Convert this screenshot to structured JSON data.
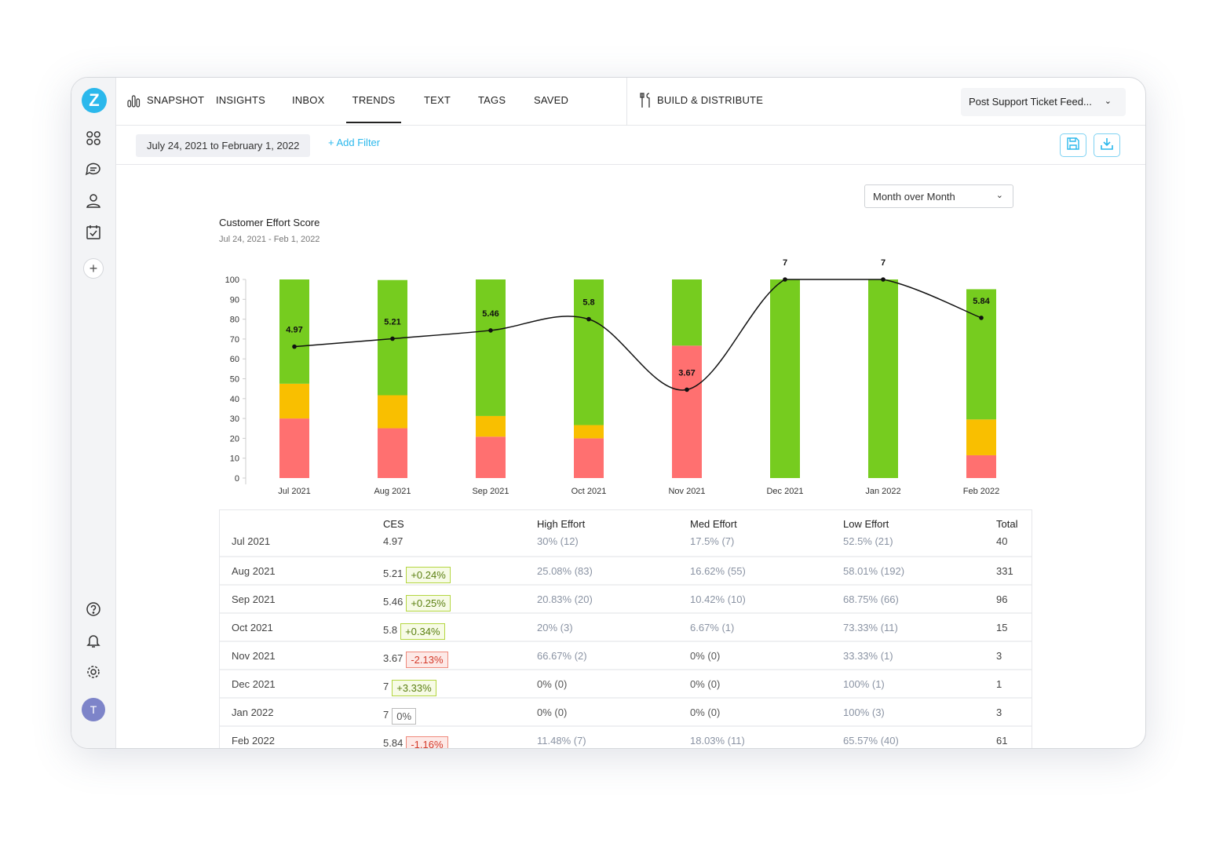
{
  "logo": "Z",
  "nav": {
    "tabs": [
      {
        "label": "SNAPSHOT"
      },
      {
        "label": "INSIGHTS"
      },
      {
        "label": "INBOX"
      },
      {
        "label": "TRENDS",
        "active": true
      },
      {
        "label": "TEXT"
      },
      {
        "label": "TAGS"
      },
      {
        "label": "SAVED"
      }
    ],
    "build": "BUILD & DISTRIBUTE",
    "survey": "Post Support Ticket Feed..."
  },
  "filter": {
    "date_range": "July 24, 2021 to February 1, 2022",
    "add_filter": "+ Add Filter"
  },
  "sidebar": {
    "avatar": "T"
  },
  "view_select": "Month over Month",
  "colors": {
    "accent": "#2bb8ec",
    "high": "#ff7070",
    "med": "#f9bf00",
    "low": "#76cc1f"
  },
  "chart_data": {
    "type": "bar",
    "stacked": true,
    "title": "Customer Effort Score",
    "subtitle": "Jul 24, 2021 - Feb 1, 2022",
    "categories": [
      "Jul 2021",
      "Aug 2021",
      "Sep 2021",
      "Oct 2021",
      "Nov 2021",
      "Dec 2021",
      "Jan 2022",
      "Feb 2022"
    ],
    "ylim": [
      0,
      100
    ],
    "yticks": [
      0,
      10,
      20,
      30,
      40,
      50,
      60,
      70,
      80,
      90,
      100
    ],
    "series": [
      {
        "key": "high",
        "values": [
          30,
          25.08,
          20.83,
          20,
          66.67,
          0,
          0,
          11.48
        ]
      },
      {
        "key": "med",
        "values": [
          17.5,
          16.62,
          10.42,
          6.67,
          0,
          0,
          0,
          18.03
        ]
      },
      {
        "key": "low",
        "values": [
          52.5,
          58.01,
          68.75,
          73.33,
          33.33,
          100,
          100,
          65.57
        ]
      }
    ],
    "line": {
      "type": "line",
      "scale": [
        1,
        7
      ],
      "values": [
        4.97,
        5.21,
        5.46,
        5.8,
        3.67,
        7,
        7,
        5.84
      ],
      "labels": [
        "4.97",
        "5.21",
        "5.46",
        "5.8",
        "3.67",
        "7",
        "7",
        "5.84"
      ]
    }
  },
  "table": {
    "headers": [
      "",
      "CES",
      "High Effort",
      "Med Effort",
      "Low Effort",
      "Total"
    ],
    "rows": [
      {
        "month": "Jul 2021",
        "ces": "4.97",
        "change": "",
        "dir": "",
        "high": "30% (12)",
        "med": "17.5% (7)",
        "low": "52.5% (21)",
        "total": "40"
      },
      {
        "month": "Aug 2021",
        "ces": "5.21",
        "change": "+0.24%",
        "dir": "pos",
        "high": "25.08% (83)",
        "med": "16.62% (55)",
        "low": "58.01% (192)",
        "total": "331"
      },
      {
        "month": "Sep 2021",
        "ces": "5.46",
        "change": "+0.25%",
        "dir": "pos",
        "high": "20.83% (20)",
        "med": "10.42% (10)",
        "low": "68.75% (66)",
        "total": "96"
      },
      {
        "month": "Oct 2021",
        "ces": "5.8",
        "change": "+0.34%",
        "dir": "pos",
        "high": "20% (3)",
        "med": "6.67% (1)",
        "low": "73.33% (11)",
        "total": "15"
      },
      {
        "month": "Nov 2021",
        "ces": "3.67",
        "change": "-2.13%",
        "dir": "neg",
        "high": "66.67% (2)",
        "med": "0% (0)",
        "low": "33.33% (1)",
        "total": "3"
      },
      {
        "month": "Dec 2021",
        "ces": "7",
        "change": "+3.33%",
        "dir": "pos",
        "high": "0% (0)",
        "med": "0% (0)",
        "low": "100% (1)",
        "total": "1"
      },
      {
        "month": "Jan 2022",
        "ces": "7",
        "change": "0%",
        "dir": "neu",
        "high": "0% (0)",
        "med": "0% (0)",
        "low": "100% (3)",
        "total": "3"
      },
      {
        "month": "Feb 2022",
        "ces": "5.84",
        "change": "-1.16%",
        "dir": "neg",
        "high": "11.48% (7)",
        "med": "18.03% (11)",
        "low": "65.57% (40)",
        "total": "61"
      }
    ]
  }
}
